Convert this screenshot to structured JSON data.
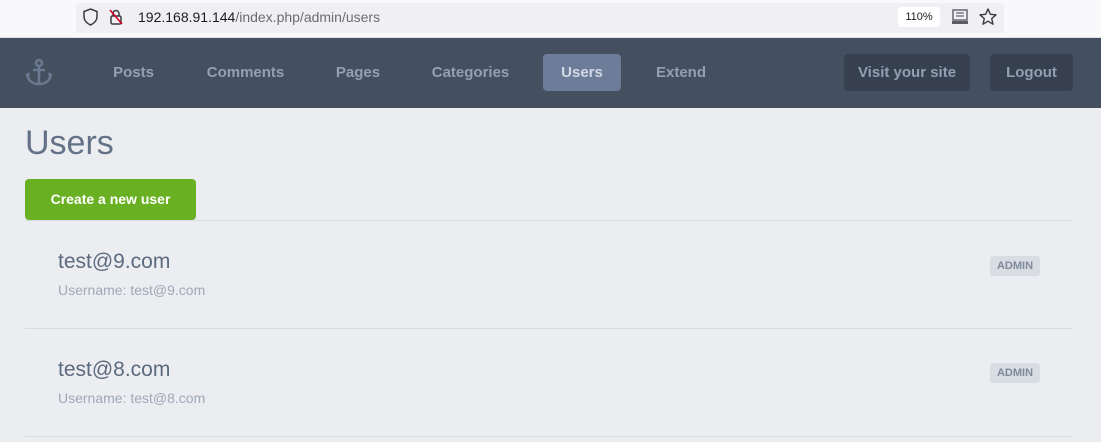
{
  "browser": {
    "url_host": "192.168.91.144",
    "url_path": "/index.php/admin/users",
    "zoom": "110%"
  },
  "nav": {
    "items": [
      {
        "label": "Posts",
        "active": false
      },
      {
        "label": "Comments",
        "active": false
      },
      {
        "label": "Pages",
        "active": false
      },
      {
        "label": "Categories",
        "active": false
      },
      {
        "label": "Users",
        "active": true
      },
      {
        "label": "Extend",
        "active": false
      }
    ],
    "visit_site": "Visit your site",
    "logout": "Logout"
  },
  "page": {
    "title": "Users",
    "create_button": "Create a new user"
  },
  "users": [
    {
      "name": "test@9.com",
      "username_line": "Username: test@9.com",
      "role": "ADMIN"
    },
    {
      "name": "test@8.com",
      "username_line": "Username: test@8.com",
      "role": "ADMIN"
    }
  ],
  "colors": {
    "nav_bg": "#444f5f",
    "active_tab": "#6c7c99",
    "create_green": "#6ab023",
    "page_bg": "#ecedf1"
  }
}
